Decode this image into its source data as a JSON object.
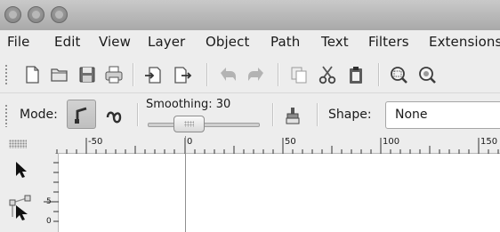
{
  "menu": {
    "file": "File",
    "edit": "Edit",
    "view": "View",
    "layer": "Layer",
    "object": "Object",
    "path": "Path",
    "text": "Text",
    "filters": "Filters",
    "extensions": "Extensions"
  },
  "tool_controls": {
    "mode_label": "Mode:",
    "smoothing_label": "Smoothing: 30",
    "smoothing_value": 30,
    "shape_label": "Shape:",
    "shape_value": "None"
  },
  "ruler": {
    "ticks": [
      "-50",
      "0",
      "50",
      "100",
      "150"
    ],
    "vertical_ticks": [
      "5",
      "0"
    ]
  },
  "icons": {
    "commands": [
      "new-document-icon",
      "open-icon",
      "save-icon",
      "print-icon",
      "import-icon",
      "export-icon",
      "undo-icon",
      "redo-icon",
      "copy-icon",
      "cut-icon",
      "paste-icon",
      "zoom-selection-icon",
      "zoom-drawing-icon"
    ],
    "modes": [
      "regular-bezier-icon",
      "spiro-path-icon"
    ],
    "tools": [
      "selector-tool-icon",
      "node-tool-icon"
    ]
  }
}
